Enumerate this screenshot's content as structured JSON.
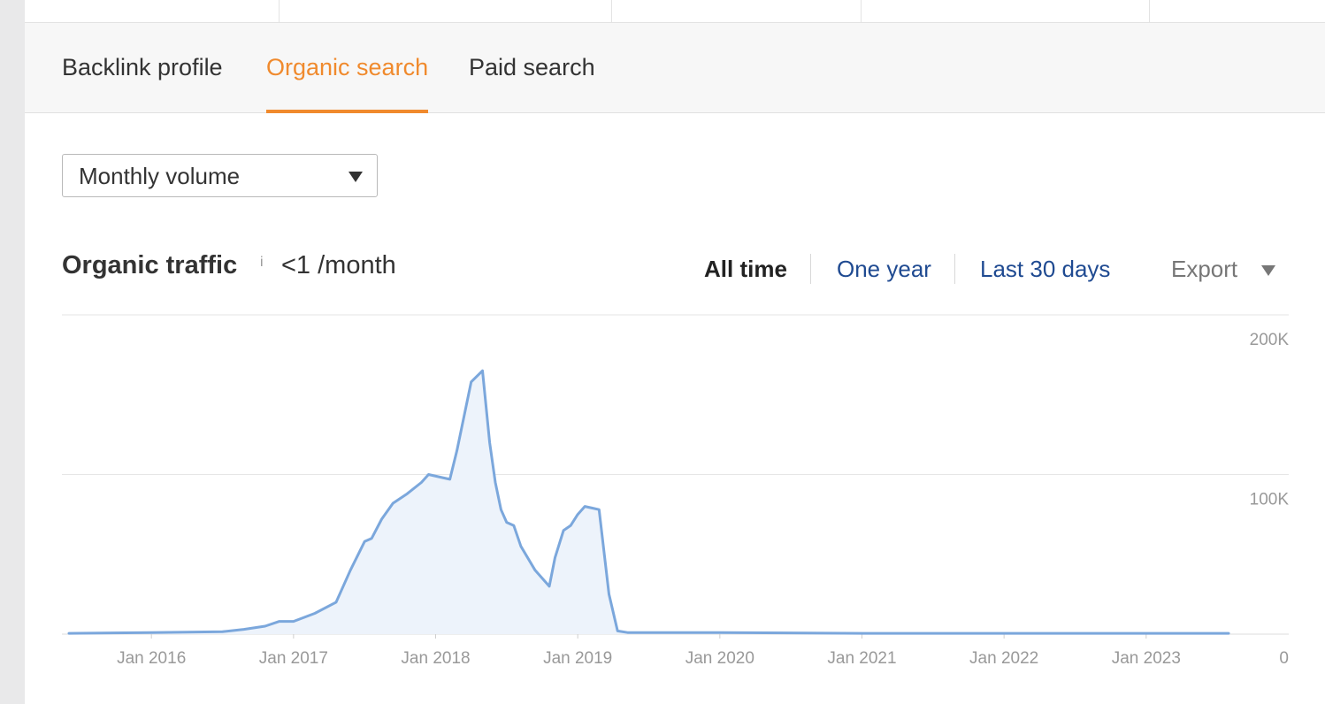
{
  "tabs": [
    {
      "label": "Backlink profile",
      "active": false
    },
    {
      "label": "Organic search",
      "active": true
    },
    {
      "label": "Paid search",
      "active": false
    }
  ],
  "volume_select": {
    "value": "Monthly volume"
  },
  "metric": {
    "title": "Organic traffic",
    "info": "i",
    "value": "<1 /month"
  },
  "ranges": [
    {
      "label": "All time",
      "active": true
    },
    {
      "label": "One year",
      "active": false
    },
    {
      "label": "Last 30 days",
      "active": false
    }
  ],
  "export": {
    "label": "Export"
  },
  "colors": {
    "accent": "#f08a2d",
    "link": "#1f4a91",
    "line": "#7ba7dc",
    "fill": "#edf3fb"
  },
  "chart_data": {
    "type": "area",
    "x_ticks": [
      "Jan 2016",
      "Jan 2017",
      "Jan 2018",
      "Jan 2019",
      "Jan 2020",
      "Jan 2021",
      "Jan 2022",
      "Jan 2023"
    ],
    "y_ticks": [
      "200K",
      "100K",
      "0"
    ],
    "ylim": [
      0,
      200000
    ],
    "xlim": [
      2015.42,
      2023.58
    ],
    "grid": true,
    "series": [
      {
        "x": [
          2015.42,
          2016.0,
          2016.5,
          2016.65,
          2016.8,
          2016.9,
          2017.0,
          2017.15,
          2017.3,
          2017.4,
          2017.5,
          2017.55,
          2017.62,
          2017.7,
          2017.8,
          2017.9,
          2017.95,
          2018.05,
          2018.1,
          2018.15,
          2018.25,
          2018.33,
          2018.38,
          2018.42,
          2018.46,
          2018.5,
          2018.55,
          2018.6,
          2018.7,
          2018.8,
          2018.84,
          2018.9,
          2018.95,
          2019.0,
          2019.05,
          2019.1,
          2019.15,
          2019.22,
          2019.28,
          2019.35,
          2020.0,
          2021.0,
          2022.0,
          2023.0,
          2023.58
        ],
        "values": [
          500,
          1000,
          1500,
          3000,
          5000,
          8000,
          8000,
          13000,
          20000,
          40000,
          58000,
          60000,
          72000,
          82000,
          88000,
          95000,
          100000,
          98000,
          97000,
          115000,
          158000,
          165000,
          120000,
          95000,
          78000,
          70000,
          68000,
          55000,
          40000,
          30000,
          48000,
          65000,
          68000,
          75000,
          80000,
          79000,
          78000,
          25000,
          2000,
          1000,
          1000,
          500,
          500,
          500,
          500
        ]
      }
    ]
  }
}
